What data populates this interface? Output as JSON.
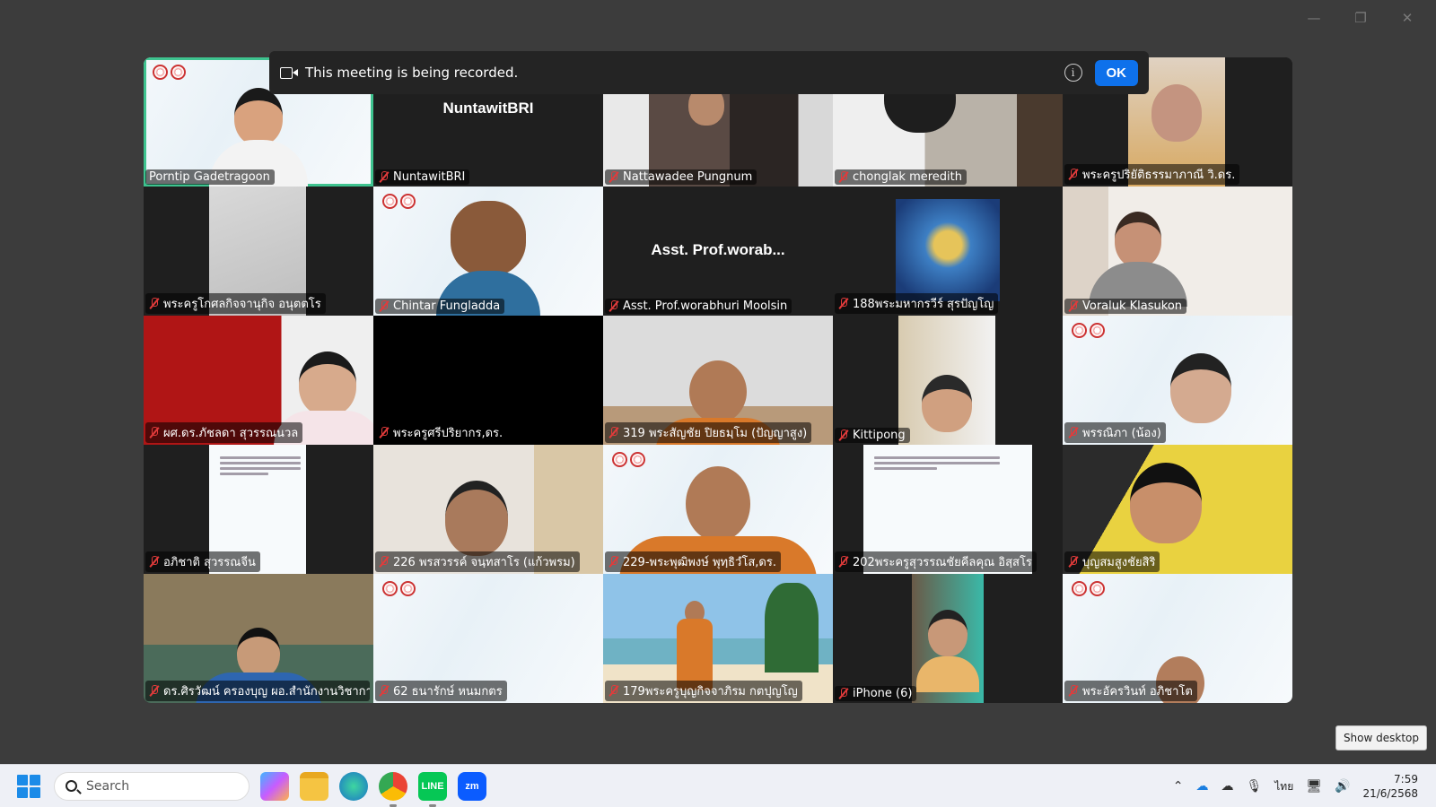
{
  "window": {
    "minimize": "—",
    "restore": "❐",
    "close": "✕"
  },
  "banner": {
    "message": "This meeting is being recorded.",
    "info": "i",
    "ok_label": "OK"
  },
  "participants": [
    {
      "name": "Porntip Gadetragoon",
      "active": true
    },
    {
      "name": "NuntawitBRI",
      "display": "NuntawitBRI"
    },
    {
      "name": "Nattawadee Pungnum"
    },
    {
      "name": "chonglak meredith"
    },
    {
      "name": "พระครูปริยัติธรรมาภาณี วิ.ดร."
    },
    {
      "name": "พระครูโกศลกิจจานุกิจ อนุตตโร"
    },
    {
      "name": "Chintar Fungladda"
    },
    {
      "name": "Asst. Prof.worabhuri Moolsin",
      "display": "Asst. Prof.worab..."
    },
    {
      "name": "188พระมหากรวีร์ สุรปัญโญ"
    },
    {
      "name": "Voraluk Klasukon"
    },
    {
      "name": "ผศ.ดร.ภัชลดา สุวรรณนวล"
    },
    {
      "name": "พระครูศรีปริยากร,ดร."
    },
    {
      "name": "319 พระสัญชัย ปิยธมฺโม (ปัญญาสูง)"
    },
    {
      "name": "Kittipong"
    },
    {
      "name": "พรรณิภา (น้อง)"
    },
    {
      "name": "อภิชาติ สุวรรณจีน"
    },
    {
      "name": "226 พรสวรรค์ จนฺทสาโร (แก้วพรม)"
    },
    {
      "name": "229-พระพุฒิพงษ์ พุทฺธิวํโส,ดร."
    },
    {
      "name": "202พระครูสุวรรณชัยคีลคุณ อิสฺสโร"
    },
    {
      "name": "บุญสมสูงชัยสิริ"
    },
    {
      "name": "ดร.ศิรวัฒน์ ครองบุญ ผอ.สำนักงานวิชาการ ว..."
    },
    {
      "name": "62 ธนารักษ์ หนมกตร"
    },
    {
      "name": "179พระครูบุญกิจจาภิรม กตปุญโญ"
    },
    {
      "name": "iPhone (6)"
    },
    {
      "name": "พระอัครวินท์ อภิชาโต"
    }
  ],
  "show_desktop": "Show desktop",
  "taskbar": {
    "search_placeholder": "Search",
    "apps": [
      "copilot",
      "file-explorer",
      "edge",
      "chrome",
      "line",
      "zoom"
    ],
    "tray_lang": "ไทย",
    "time": "7:59",
    "date": "21/6/2568"
  },
  "colors": {
    "active_border": "#3ec38f",
    "ok_button": "#0e71eb",
    "muted_mic": "#e23b3b"
  }
}
